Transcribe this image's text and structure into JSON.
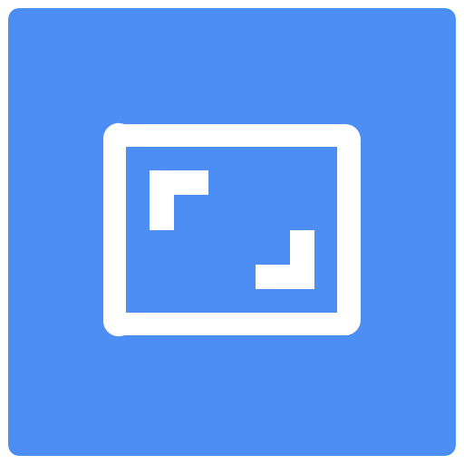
{
  "icon": {
    "name": "aspect-ratio-icon",
    "background_color": "#4D8EF5",
    "foreground_color": "#FFFFFF"
  }
}
